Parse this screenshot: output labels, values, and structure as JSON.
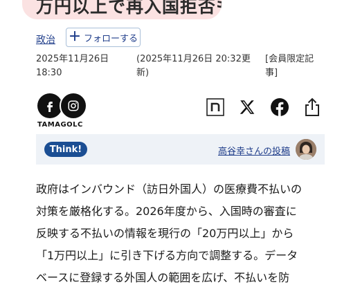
{
  "headline": {
    "text": "万円以上で再入国拒否も"
  },
  "category": {
    "label": "政治"
  },
  "follow": {
    "label": "フォローする"
  },
  "meta": {
    "published_date": "2025年11月26日",
    "published_time": "18:30",
    "updated_line1": "(2025年11月26日 20:32更",
    "updated_line2": "新)",
    "members_line1": "[会員限定記",
    "members_line2": "事]"
  },
  "author": {
    "name": "TAMAGOLC"
  },
  "share": {
    "icons": [
      "note-icon",
      "x-icon",
      "facebook-icon",
      "share-icon"
    ]
  },
  "think": {
    "badge": "Think!",
    "post_link": "高谷幸さんの投稿"
  },
  "article": {
    "lines": [
      "政府はインバウンド（訪日外国人）の医療費不払いの",
      "対策を厳格化する。2026年度から、入国時の審査に",
      "反映する不払いの情報を現行の「20万円以上」から",
      "「1万円以上」に引き下げる方向で調整する。データ",
      "ベースに登録する外国人の範囲を広げ、不払いを防"
    ]
  },
  "colors": {
    "headline_bg": "#fbe2e2",
    "link": "#1f3d8a",
    "think_bg": "#eef2f7",
    "think_badge": "#1b4e93"
  }
}
